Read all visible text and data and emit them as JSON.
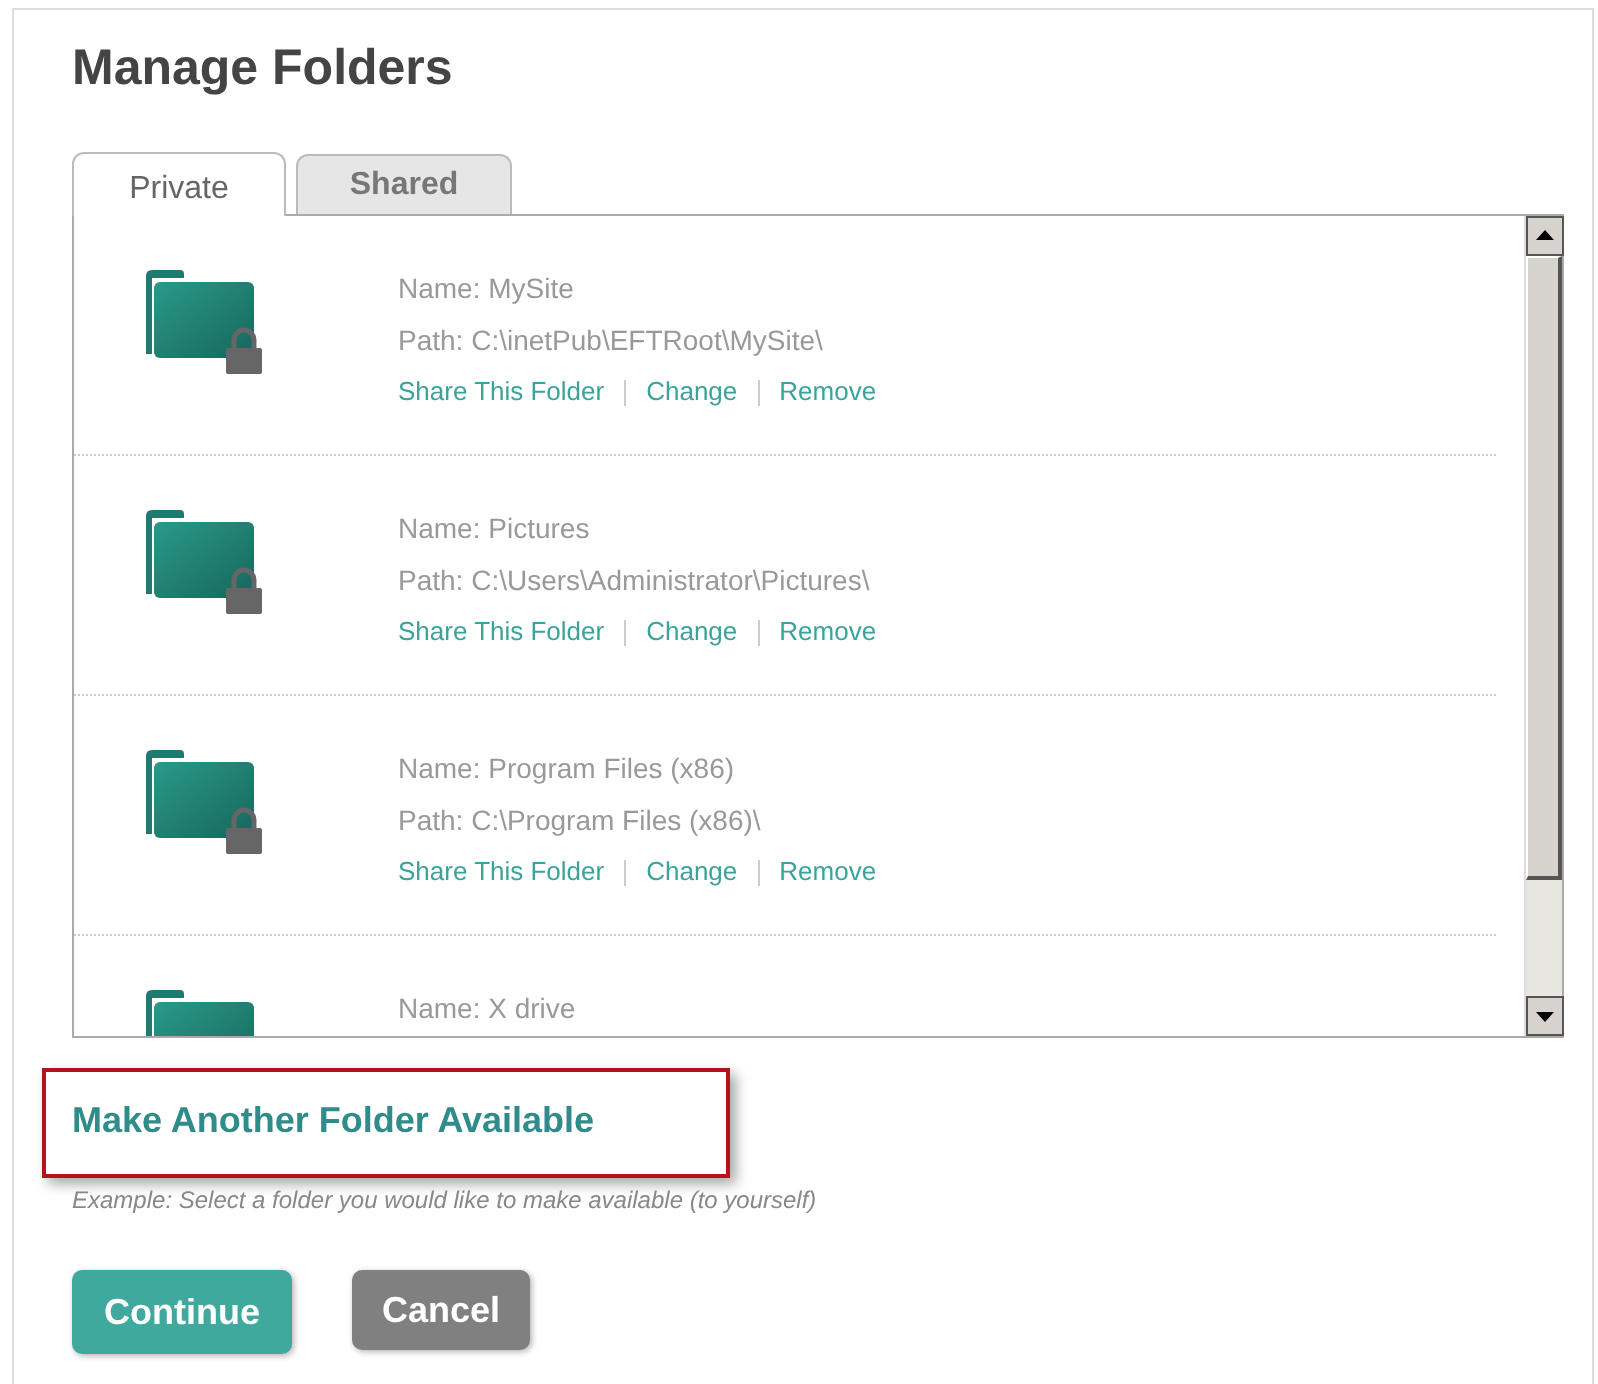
{
  "title": "Manage Folders",
  "tabs": [
    {
      "label": "Private",
      "selected": true
    },
    {
      "label": "Shared",
      "selected": false
    }
  ],
  "folders": [
    {
      "name": "Name: MySite",
      "path": "Path: C:\\inetPub\\EFTRoot\\MySite\\",
      "actions": [
        "Share This Folder",
        "Change",
        "Remove"
      ]
    },
    {
      "name": "Name: Pictures",
      "path": "Path: C:\\Users\\Administrator\\Pictures\\",
      "actions": [
        "Share This Folder",
        "Change",
        "Remove"
      ]
    },
    {
      "name": "Name: Program Files (x86)",
      "path": "Path: C:\\Program Files (x86)\\",
      "actions": [
        "Share This Folder",
        "Change",
        "Remove"
      ]
    },
    {
      "name": "Name: X drive"
    }
  ],
  "add_link": {
    "label": "Make Another Folder Available",
    "highlighted": true
  },
  "hint": "Example: Select a folder you would like to make available (to yourself)",
  "buttons": [
    {
      "label": "Continue",
      "kind": "primary"
    },
    {
      "label": "Cancel",
      "kind": "secondary"
    }
  ]
}
